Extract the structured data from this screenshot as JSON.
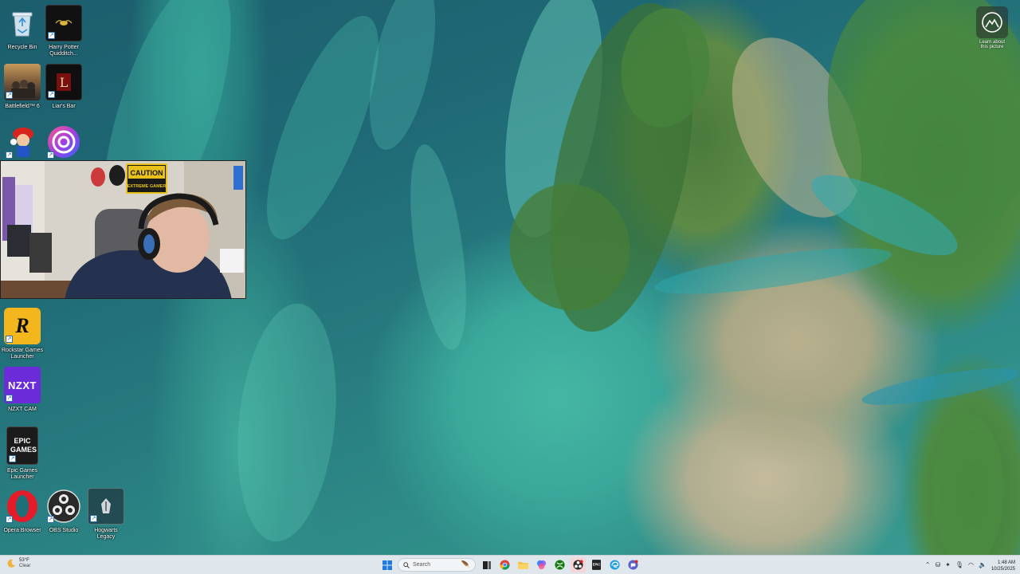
{
  "desktop": {
    "icons": [
      {
        "id": "recycle-bin",
        "label": "Recycle Bin"
      },
      {
        "id": "quidditch",
        "label": "Harry Potter Quidditch..."
      },
      {
        "id": "battlefield",
        "label": "Battlefield™ 6"
      },
      {
        "id": "liars-bar",
        "label": "Liar's Bar"
      },
      {
        "id": "mario",
        "label": ""
      },
      {
        "id": "ubisoft",
        "label": ""
      },
      {
        "id": "rockstar",
        "label": "Rockstar Games Launcher",
        "glyph": "R"
      },
      {
        "id": "nzxt",
        "label": "NZXT CAM",
        "glyph": "NZXT"
      },
      {
        "id": "epic",
        "label": "Epic Games Launcher",
        "glyph": "EPIC GAMES"
      },
      {
        "id": "opera",
        "label": "Opera Browser"
      },
      {
        "id": "obs",
        "label": "OBS Studio"
      },
      {
        "id": "hogwarts",
        "label": "Hogwarts Legacy"
      }
    ]
  },
  "webcam": {
    "sign_line1": "CAUTION",
    "sign_line2": "EXTREME GAMER"
  },
  "corner_widget": {
    "label": "Learn about this picture"
  },
  "taskbar": {
    "weather_temp": "53°F",
    "weather_condition": "Clear",
    "search_placeholder": "Search",
    "time": "1:48 AM",
    "date": "10/25/2025"
  }
}
